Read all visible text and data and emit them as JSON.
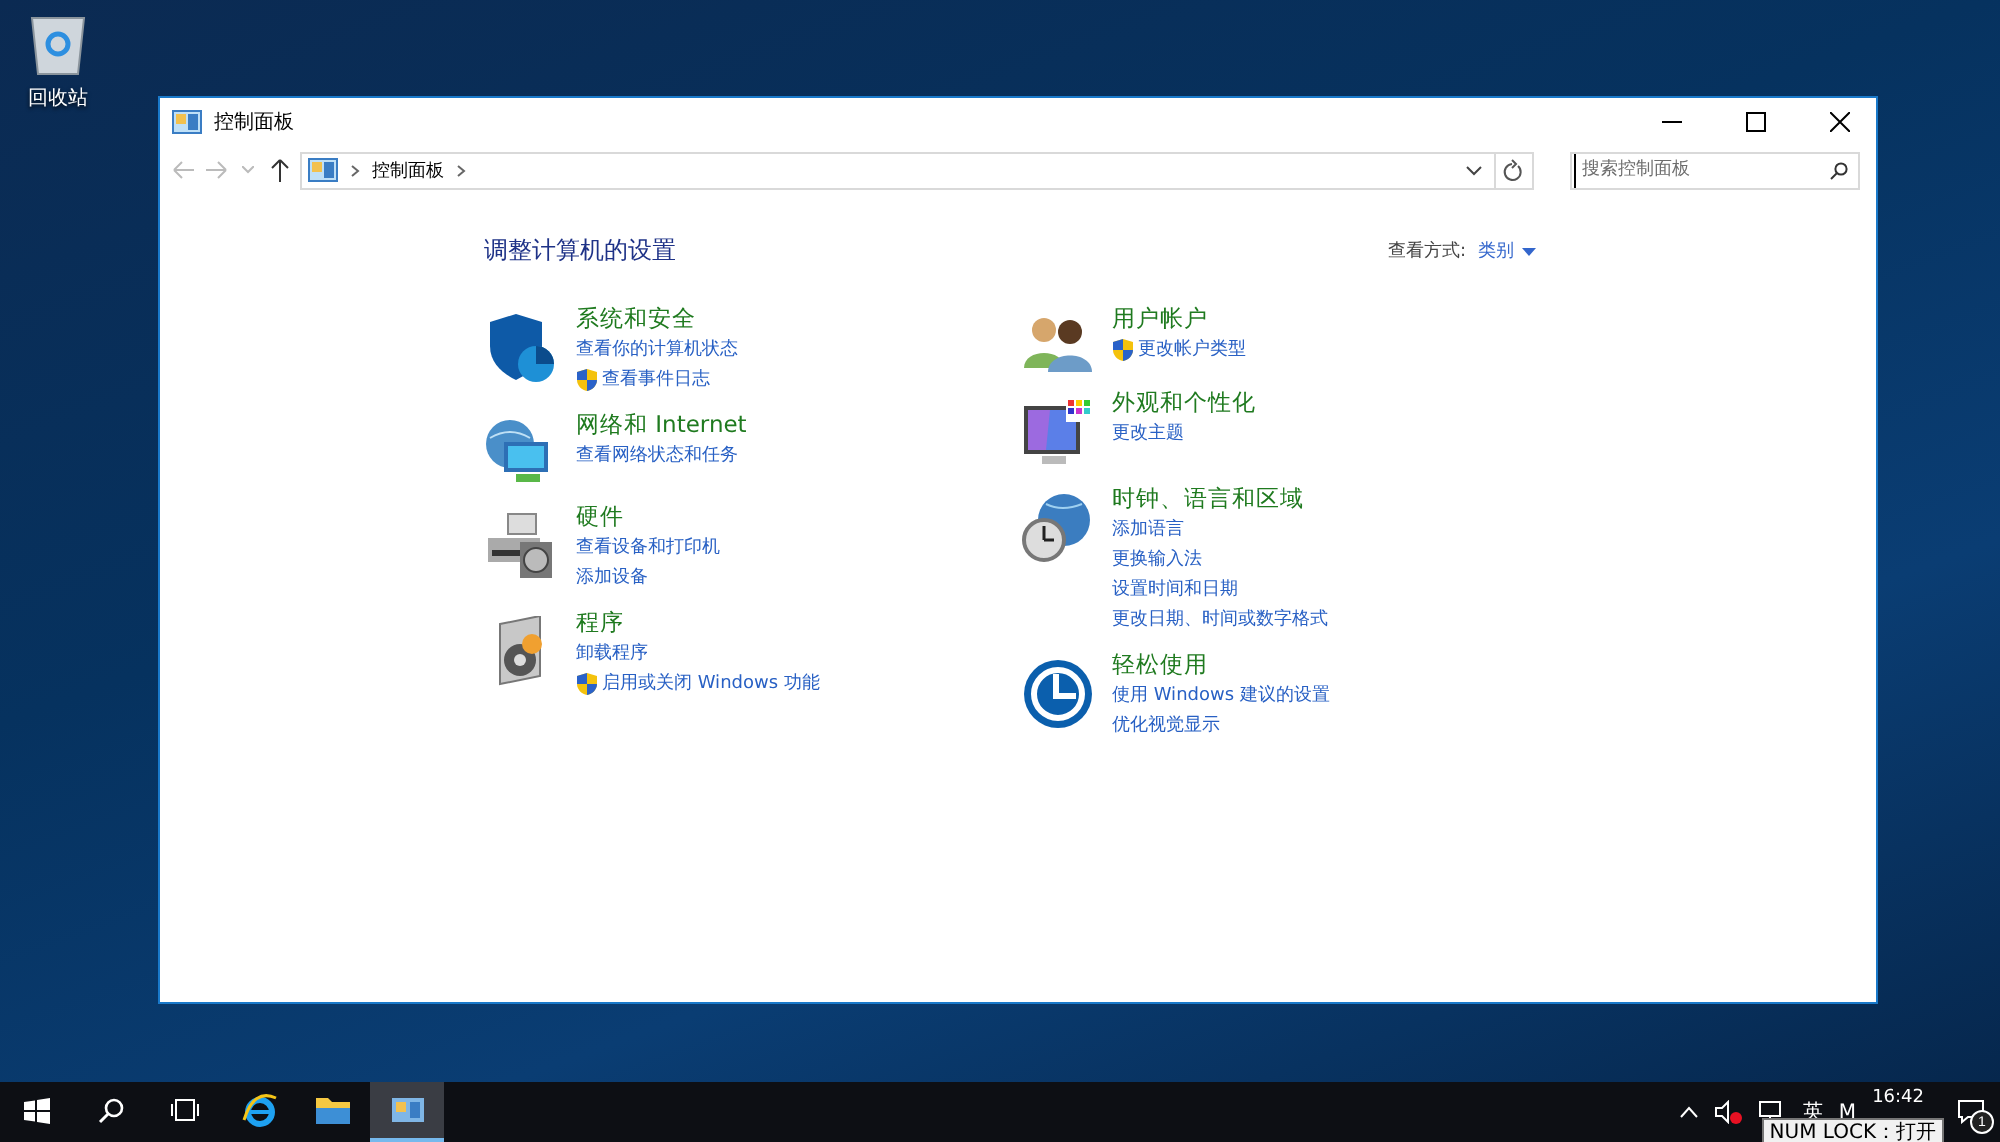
{
  "desktop_icons": [
    {
      "label": "回收站"
    }
  ],
  "window": {
    "title": "控制面板",
    "address": {
      "breadcrumb": [
        "控制面板"
      ]
    },
    "search": {
      "placeholder": "搜索控制面板"
    }
  },
  "content": {
    "heading": "调整计算机的设置",
    "view_by": {
      "label": "查看方式:",
      "value": "类别"
    },
    "columns": [
      [
        {
          "kind": "security",
          "title": "系统和安全",
          "links": [
            {
              "text": "查看你的计算机状态",
              "shield": false
            },
            {
              "text": "查看事件日志",
              "shield": true
            }
          ]
        },
        {
          "kind": "network",
          "title": "网络和 Internet",
          "links": [
            {
              "text": "查看网络状态和任务",
              "shield": false
            }
          ]
        },
        {
          "kind": "hardware",
          "title": "硬件",
          "links": [
            {
              "text": "查看设备和打印机",
              "shield": false
            },
            {
              "text": "添加设备",
              "shield": false
            }
          ]
        },
        {
          "kind": "programs",
          "title": "程序",
          "links": [
            {
              "text": "卸载程序",
              "shield": false
            },
            {
              "text": "启用或关闭 Windows 功能",
              "shield": true
            }
          ]
        }
      ],
      [
        {
          "kind": "users",
          "title": "用户帐户",
          "links": [
            {
              "text": "更改帐户类型",
              "shield": true
            }
          ]
        },
        {
          "kind": "appearance",
          "title": "外观和个性化",
          "links": [
            {
              "text": "更改主题",
              "shield": false
            }
          ]
        },
        {
          "kind": "clock",
          "title": "时钟、语言和区域",
          "links": [
            {
              "text": "添加语言",
              "shield": false
            },
            {
              "text": "更换输入法",
              "shield": false
            },
            {
              "text": "设置时间和日期",
              "shield": false
            },
            {
              "text": "更改日期、时间或数字格式",
              "shield": false
            }
          ]
        },
        {
          "kind": "ease",
          "title": "轻松使用",
          "links": [
            {
              "text": "使用 Windows 建议的设置",
              "shield": false
            },
            {
              "text": "优化视觉显示",
              "shield": false
            }
          ]
        }
      ]
    ]
  },
  "taskbar": {
    "apps": [
      {
        "kind": "start",
        "selected": false
      },
      {
        "kind": "search",
        "selected": false
      },
      {
        "kind": "taskview",
        "selected": false
      },
      {
        "kind": "ie",
        "selected": false
      },
      {
        "kind": "explorer",
        "selected": false
      },
      {
        "kind": "controlpanel",
        "selected": true
      }
    ],
    "tray": {
      "input_language": "英",
      "ime": "M",
      "time": "16:42",
      "notifications": "1"
    },
    "tooltip": "NUM LOCK：打开"
  }
}
